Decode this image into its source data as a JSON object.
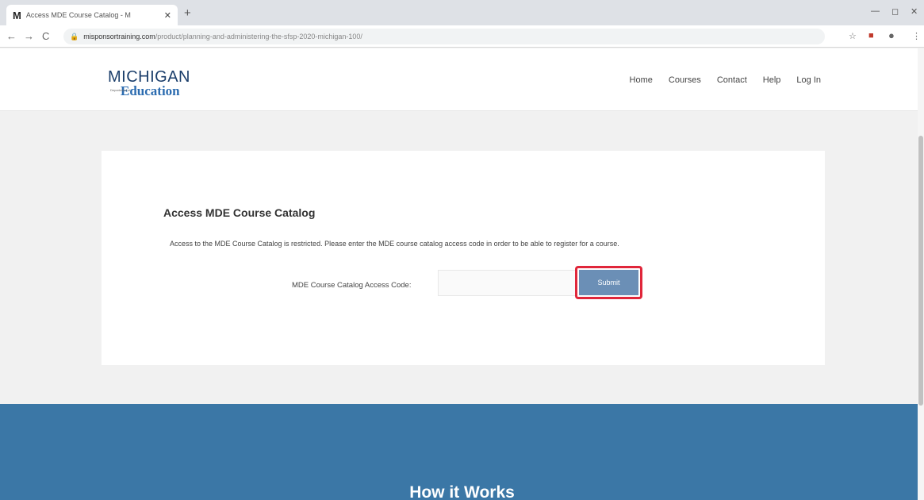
{
  "browser": {
    "tab_favicon": "M",
    "tab_title": "Access MDE Course Catalog - M",
    "tab_close": "✕",
    "new_tab": "+",
    "url_domain": "misponsortraining.com",
    "url_path": "/product/planning-and-administering-the-sfsp-2020-michigan-100/",
    "back": "←",
    "forward": "→",
    "reload": "C"
  },
  "header": {
    "logo_top": "MICHIGAN",
    "logo_dept": "Department of",
    "logo_bottom": "Education",
    "nav": [
      "Home",
      "Courses",
      "Contact",
      "Help",
      "Log In"
    ]
  },
  "card": {
    "heading": "Access MDE Course Catalog",
    "description": "Access to the MDE Course Catalog is restricted. Please enter the MDE course catalog access code in order to be able to register for a course.",
    "code_label": "MDE Course Catalog Access Code:",
    "code_value": "",
    "submit_label": "Submit"
  },
  "band": {
    "title": "How it Works",
    "color": "#3b77a6"
  },
  "icons": [
    "lock-icon",
    "star-icon",
    "extension-icon",
    "profile-icon",
    "menu-icon",
    "minimize-icon",
    "maximize-icon",
    "close-icon"
  ]
}
